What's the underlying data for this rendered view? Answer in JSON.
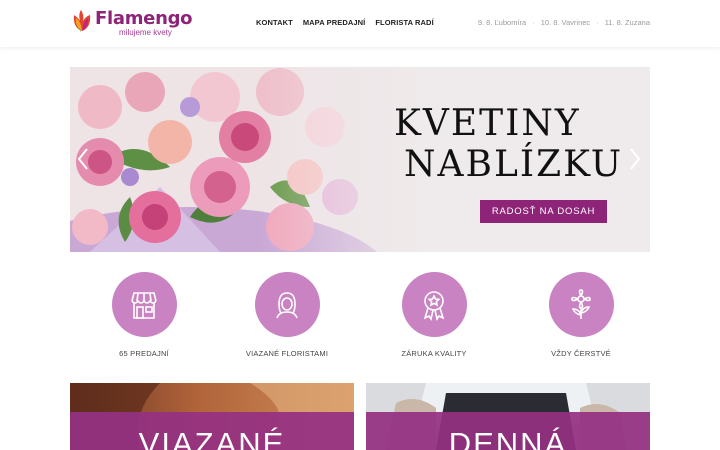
{
  "brand": {
    "name": "Flamengo",
    "tagline": "milujeme kvety",
    "colors": {
      "primary": "#8e2478",
      "icon_circle": "#c982c2"
    }
  },
  "nav": {
    "items": [
      "KONTAKT",
      "MAPA PREDAJNÍ",
      "FLORISTA RADÍ"
    ]
  },
  "namedays": [
    "9. 8. Ľubomíra",
    "10. 8. Vavrinec",
    "11. 8. Zuzana"
  ],
  "hero": {
    "title_line1": "KVETINY",
    "title_line2": "NABLÍZKU",
    "cta_label": "RADOSŤ NA DOSAH",
    "prev_icon": "chevron-left-icon",
    "next_icon": "chevron-right-icon"
  },
  "features": [
    {
      "icon": "storefront-icon",
      "label": "65 PREDAJNÍ"
    },
    {
      "icon": "florist-avatar-icon",
      "label": "VIAZANÉ FLORISTAMI"
    },
    {
      "icon": "quality-award-icon",
      "label": "ZÁRUKA KVALITY"
    },
    {
      "icon": "flower-icon",
      "label": "VŽDY ČERSTVÉ"
    }
  ],
  "cards": [
    {
      "title": "VIAZANÉ"
    },
    {
      "title": "DENNÁ"
    }
  ]
}
